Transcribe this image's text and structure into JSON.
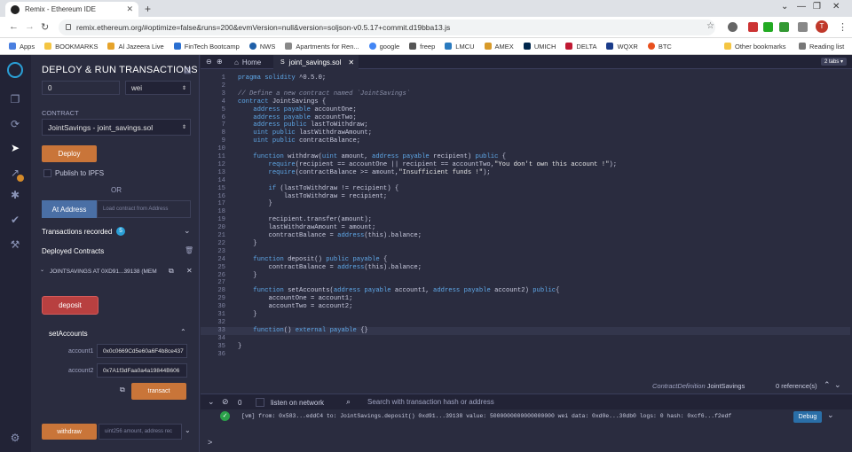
{
  "browser": {
    "tab_title": "Remix - Ethereum IDE",
    "new_tab": "+",
    "url": "remix.ethereum.org/#optimize=false&runs=200&evmVersion=null&version=soljson-v0.5.17+commit.d19bba13.js",
    "profile_initial": "T",
    "bookmarks": [
      "Apps",
      "BOOKMARKS",
      "Al Jazeera Live",
      "FinTech Bootcamp",
      "NWS",
      "Apartments for Ren...",
      "google",
      "freep",
      "LMCU",
      "AMEX",
      "UMICH",
      "DELTA",
      "WQXR",
      "BTC"
    ],
    "other_bookmarks": "Other bookmarks",
    "reading_list": "Reading list"
  },
  "panel": {
    "title": "DEPLOY & RUN TRANSACTIONS",
    "value": "0",
    "unit": "wei",
    "contract_label": "CONTRACT",
    "contract_selected": "JointSavings - joint_savings.sol",
    "deploy": "Deploy",
    "publish_ipfs": "Publish to IPFS",
    "or": "OR",
    "at_address": "At Address",
    "load_placeholder": "Load contract from Address",
    "transactions_recorded": "Transactions recorded",
    "transactions_count": "5",
    "deployed_contracts": "Deployed Contracts",
    "instance": "JOINTSAVINGS AT 0XD91...39138 (MEM",
    "deposit": "deposit",
    "set_accounts": "setAccounts",
    "account1_label": "account1",
    "account1_value": "0x0c0669Cd5e60a6F4b8ce437",
    "account2_label": "account2",
    "account2_value": "0x7A1f3dFaa0a4a19844B606",
    "transact": "transact",
    "withdraw": "withdraw",
    "withdraw_placeholder": "uint256 amount, address rec"
  },
  "editor": {
    "home_tab": "Home",
    "file_tab": "joint_savings.sol",
    "tabs_badge": "2 tabs",
    "lines": [
      "pragma solidity ^0.5.0;",
      "",
      "// Define a new contract named `JointSavings`",
      "contract JointSavings {",
      "    address payable accountOne;",
      "    address payable accountTwo;",
      "    address public lastToWithdraw;",
      "    uint public lastWithdrawAmount;",
      "    uint public contractBalance;",
      "",
      "    function withdraw(uint amount, address payable recipient) public {",
      "        require(recipient == accountOne || recipient == accountTwo,\"You don't own this account !\");",
      "        require(contractBalance >= amount,\"Insufficient funds !\");",
      "",
      "        if (lastToWithdraw != recipient) {",
      "            lastToWithdraw = recipient;",
      "        }",
      "",
      "        recipient.transfer(amount);",
      "        lastWithdrawAmount = amount;",
      "        contractBalance = address(this).balance;",
      "    }",
      "",
      "    function deposit() public payable {",
      "        contractBalance = address(this).balance;",
      "    }",
      "",
      "    function setAccounts(address payable account1, address payable account2) public{",
      "        accountOne = account1;",
      "        accountTwo = account2;",
      "    }",
      "",
      "    function() external payable {}",
      "",
      "}",
      ""
    ],
    "context_prefix": "ContractDefinition",
    "context_name": "JointSavings",
    "references": "0 reference(s)"
  },
  "terminal": {
    "count": "0",
    "listen_label": "listen on network",
    "search_placeholder": "Search with transaction hash or address",
    "log": "[vm] from: 0x583...eddC4 to: JointSavings.deposit() 0xd91...39138 value: 5000000000000000000 wei data: 0xd0e...30db0 logs: 0 hash: 0xcf6...f2edf",
    "debug": "Debug",
    "prompt": ">"
  },
  "colors": {
    "accent_orange": "#c97539",
    "deposit_red": "#b84040",
    "keyword": "#5fa8e8",
    "string": "#e6e6e6"
  }
}
